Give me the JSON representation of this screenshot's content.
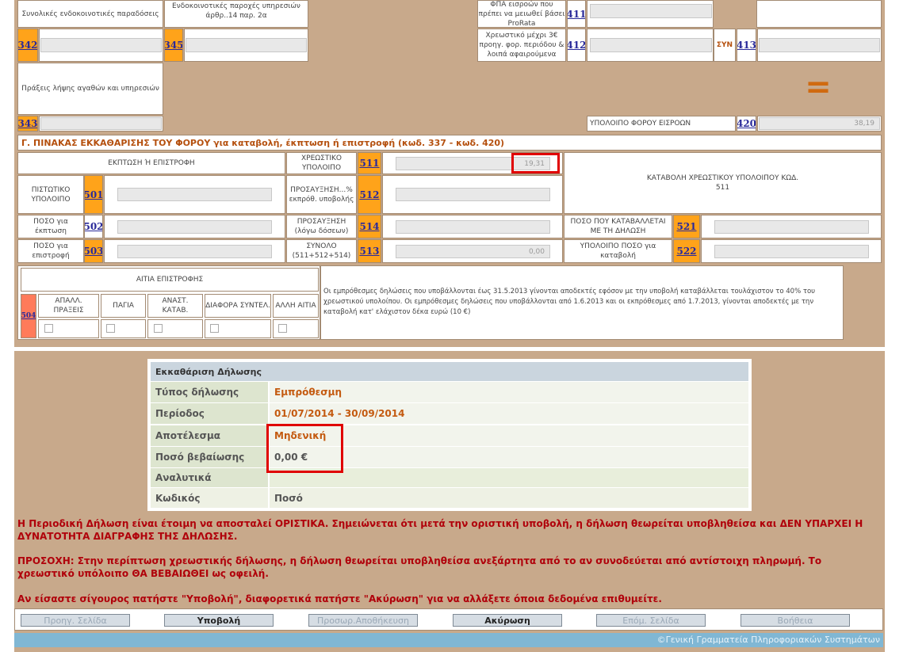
{
  "top": {
    "cell_intra_community_deliveries": "Συνολικές ενδοκοινοτικές παραδόσεις",
    "cell_intra_community_services": "Ενδοκοινοτικές παροχές υπηρεσιών άρθρ..14 παρ. 2α",
    "cell_vat_prorata": "ΦΠΑ εισροών που πρέπει να μειωθεί βάσει ProRata",
    "code_411": "411",
    "code_342": "342",
    "code_345": "345",
    "cell_debit_prev": "Χρεωστικό μέχρι 3€ προηγ. φορ. περιόδου & λοιπά αφαιρούμενα",
    "code_412": "412",
    "label_syn": "ΣΥΝ",
    "code_413": "413",
    "cell_purchases": "Πράξεις λήψης αγαθών και υπηρεσιών",
    "equals_sign": "=",
    "code_343": "343",
    "label_input_tax_balance": "ΥΠΟΛΟΙΠΟ ΦΟΡΟΥ ΕΙΣΡΟΩΝ",
    "code_420": "420",
    "value_420": "38,19"
  },
  "section_c": {
    "title": "Γ. ΠΙΝΑΚΑΣ ΕΚΚΑΘΑΡΙΣΗΣ ΤΟΥ ΦΟΡΟΥ για καταβολή, έκπτωση ή επιστροφή (κωδ. 337 - κωδ. 420)",
    "deduction_refund": "ΕΚΠΤΩΣΗ Ή ΕΠΙΣΤΡΟΦΗ",
    "credit_balance": "ΠΙΣΤΩΤΙΚΟ ΥΠΟΛΟΙΠΟ",
    "code_501": "501",
    "amount_deduction": "ΠΟΣΟ για έκπτωση",
    "code_502": "502",
    "amount_refund": "ΠΟΣΟ για επιστροφή",
    "code_503": "503",
    "debit_balance": "ΧΡΕΩΣΤΙΚΟ ΥΠΟΛΟΙΠΟ",
    "code_511": "511",
    "value_511": "19,31",
    "surcharge_pct": "ΠΡΟΣΑΥΞΗΣΗ...% εκπρόθ. υποβολής",
    "code_512": "512",
    "surcharge_installments": "ΠΡΟΣΑΥΞΗΣΗ (λόγω δόσεων)",
    "code_514": "514",
    "total": "ΣΥΝΟΛΟ (511+512+514)",
    "code_513": "513",
    "value_513": "0,00",
    "payment_debit": "ΚΑΤΑΒΟΛΗ ΧΡΕΩΣΤΙΚΟΥ ΥΠΟΛΟΙΠΟΥ ΚΩΔ. 511",
    "amount_paid_with_return": "ΠΟΣΟ ΠΟΥ ΚΑΤΑΒΑΛΛΕΤΑΙ ΜΕ ΤΗ ΔΗΛΩΣΗ",
    "code_521": "521",
    "remaining_amount": "ΥΠΟΛΟΙΠΟ ΠΟΣΟ για καταβολή",
    "code_522": "522"
  },
  "refund_reasons": {
    "title": "ΑΙΤΙΑ ΕΠΙΣΤΡΟΦΗΣ",
    "code_504": "504",
    "col_exempt": "ΑΠΑΛΛ. ΠΡΑΞΕΙΣ",
    "col_assets": "ΠΑΓΙΑ",
    "col_rate_diff": "ΑΝΑΣΤ. ΚΑΤΑΒ.",
    "col_diff_coef": "ΔΙΑΦΟΡΑ ΣΥΝΤΕΛ.",
    "col_other": "ΑΛΛΗ ΑΙΤΙΑ",
    "note": "Οι εμπρόθεσμες δηλώσεις που υποβάλλονται έως 31.5.2013 γίνονται αποδεκτές εφόσον με την υποβολή καταβάλλεται τουλάχιστον το 40% του χρεωστικού υπολοίπου. Οι εμπρόθεσμες δηλώσεις που υποβάλλονται από 1.6.2013 και οι εκπρόθεσμες από 1.7.2013, γίνονται αποδεκτές με την καταβολή κατ' ελάχιστον δέκα ευρώ (10 €)"
  },
  "summary": {
    "title": "Εκκαθάριση Δήλωσης",
    "rows": [
      {
        "label": "Τύπος δήλωσης",
        "value": "Εμπρόθεσμη"
      },
      {
        "label": "Περίοδος",
        "value": "01/07/2014 - 30/09/2014"
      },
      {
        "label": "Αποτέλεσμα",
        "value": "Μηδενική"
      },
      {
        "label": "Ποσό βεβαίωσης",
        "value": "0,00 €"
      },
      {
        "label": "Αναλυτικά",
        "value": ""
      },
      {
        "label": "Κωδικός",
        "value": "Ποσό"
      }
    ]
  },
  "notice": {
    "line1": "Η Περιοδική Δήλωση είναι έτοιμη να αποσταλεί ΟΡΙΣΤΙΚΑ. Σημειώνεται ότι μετά την οριστική υποβολή, η δήλωση θεωρείται υποβληθείσα και ΔΕΝ ΥΠΑΡΧΕΙ Η ΔΥΝΑΤΟΤΗΤΑ ΔΙΑΓΡΑΦΗΣ ΤΗΣ ΔΗΛΩΣΗΣ.",
    "line2": "ΠΡΟΣΟΧΗ: Στην περίπτωση χρεωστικής δήλωσης, η δήλωση θεωρείται υποβληθείσα ανεξάρτητα από το αν συνοδεύεται από αντίστοιχη πληρωμή. Το χρεωστικό υπόλοιπο ΘΑ ΒΕΒΑΙΩΘΕΙ ως οφειλή.",
    "line3": "Αν είσαστε σίγουρος πατήστε \"Υποβολή\", διαφορετικά πατήστε \"Ακύρωση\" για να αλλάξετε όποια δεδομένα επιθυμείτε."
  },
  "buttons": {
    "prev_page": "Προηγ. Σελίδα",
    "submit": "Υποβολή",
    "temp_save": "Προσωρ.Αποθήκευση",
    "cancel": "Ακύρωση",
    "next_page": "Επόμ. Σελίδα",
    "help": "Βοήθεια"
  },
  "footer": "©Γενική Γραμματεία Πληροφοριακών Συστημάτων",
  "colors": {
    "frame_bg": "#c8a98b",
    "code_orange": "#ffa31a",
    "highlight_red": "#e00000",
    "notice_red": "#b0000a",
    "footer_blue": "#80b7d4"
  }
}
